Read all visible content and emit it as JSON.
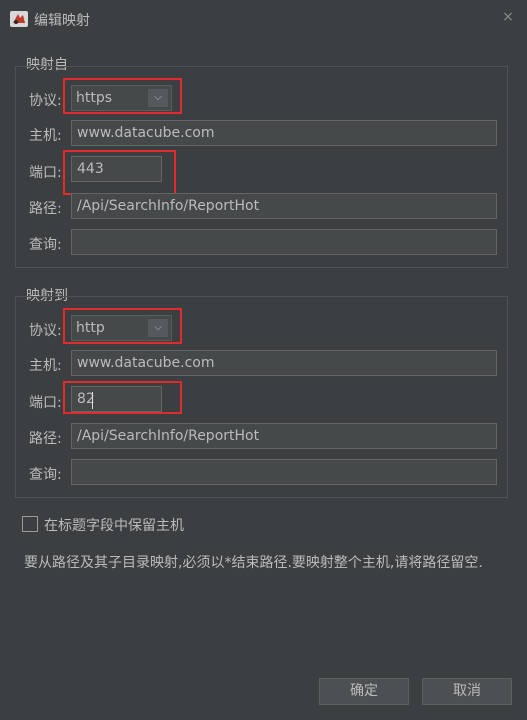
{
  "window": {
    "title": "编辑映射",
    "close_glyph": "×",
    "icon": "app-icon"
  },
  "map_from": {
    "title": "映射自",
    "protocol_label": "协议:",
    "protocol_value": "https",
    "host_label": "主机:",
    "host_value": "www.datacube.com",
    "port_label": "端口:",
    "port_value": "443",
    "path_label": "路径:",
    "path_value": "/Api/SearchInfo/ReportHot",
    "query_label": "查询:",
    "query_value": ""
  },
  "map_to": {
    "title": "映射到",
    "protocol_label": "协议:",
    "protocol_value": "http",
    "host_label": "主机:",
    "host_value": "www.datacube.com",
    "port_label": "端口:",
    "port_value": "82",
    "path_label": "路径:",
    "path_value": "/Api/SearchInfo/ReportHot",
    "query_label": "查询:",
    "query_value": ""
  },
  "options": {
    "preserve_host_label": "在标题字段中保留主机",
    "preserve_host_checked": false
  },
  "note": "要从路径及其子目录映射,必须以*结束路径.要映射整个主机,请将路径留空.",
  "buttons": {
    "ok": "确定",
    "cancel": "取消"
  },
  "colors": {
    "background": "#3c3f41",
    "field": "#45494a",
    "text": "#bbbbbb",
    "highlight": "#e32b2b"
  }
}
